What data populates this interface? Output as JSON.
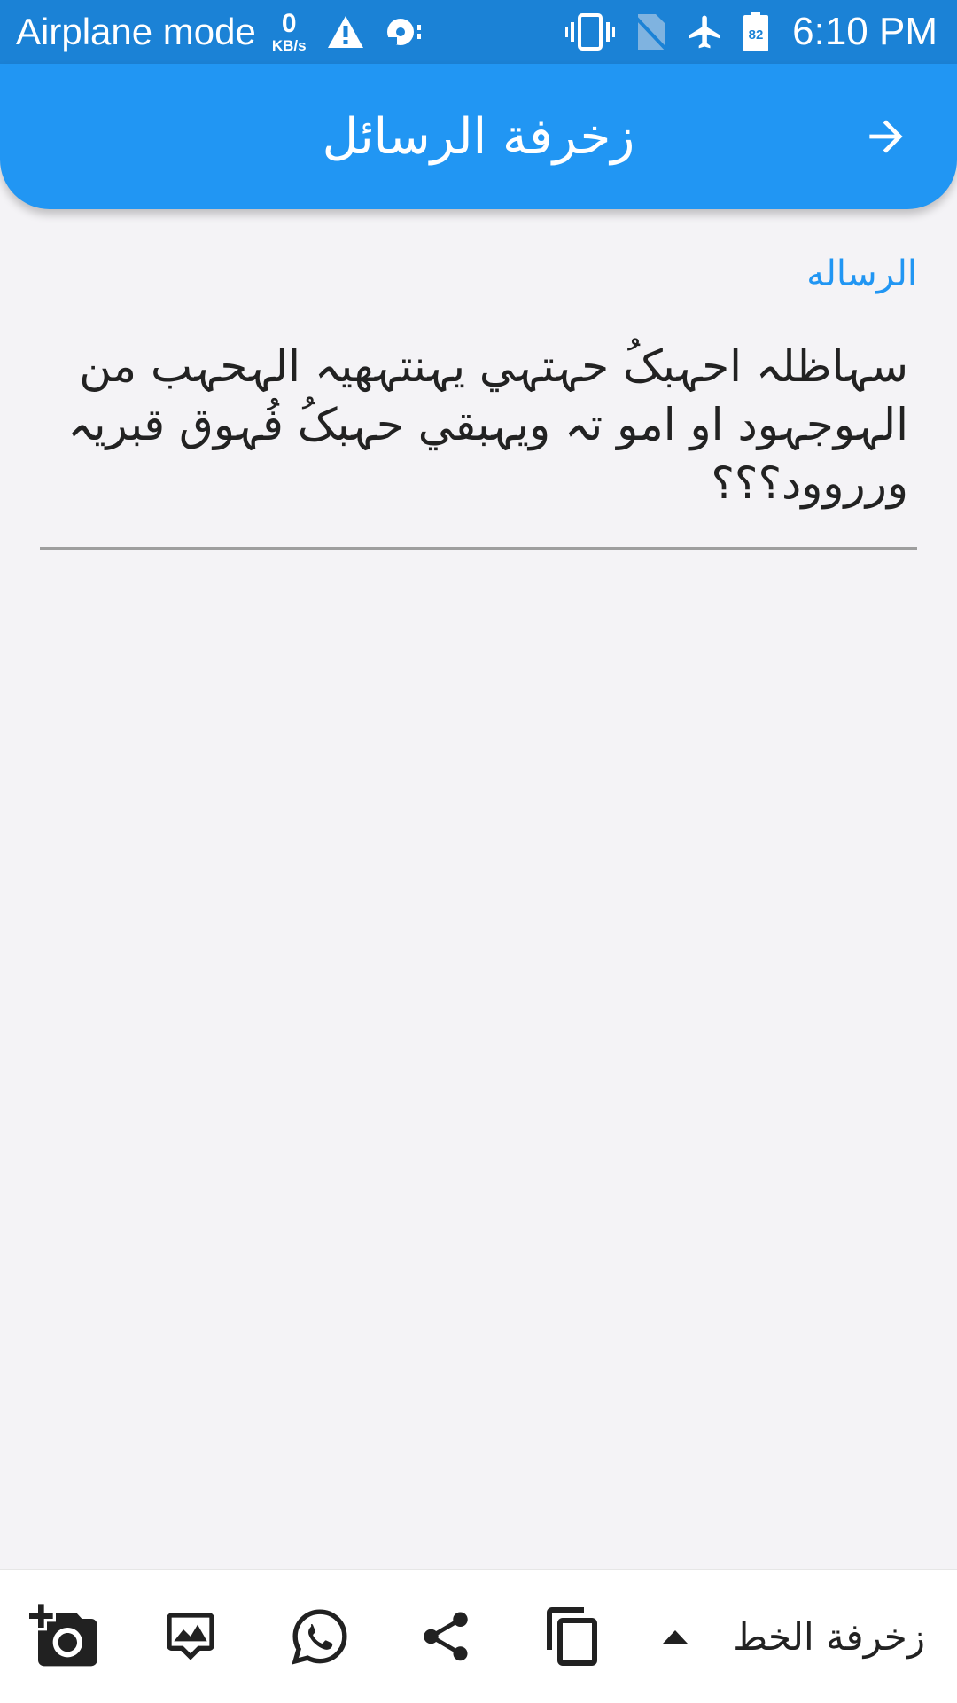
{
  "status_bar": {
    "mode_text": "Airplane mode",
    "speed_value": "0",
    "speed_unit": "KB/s",
    "battery_level": "82",
    "time": "6:10 PM",
    "icons": [
      "warning-icon",
      "cloud-sync-icon",
      "vibrate-icon",
      "no-sim-icon",
      "airplane-icon",
      "battery-icon"
    ]
  },
  "app_bar": {
    "title": "زخرفة الرسائل",
    "back_icon": "arrow-forward-icon"
  },
  "message": {
    "label": "الرساله",
    "value": "سہاظلہ احہبکُ حہتہي يہنتہهيہ الہحہب من الہوجہود او امو تہ ويہبقي حہبکُ فُہوق قبريہ ورروود؟؟؟"
  },
  "toolbar": {
    "font_label": "زخرفة الخط",
    "buttons": [
      "add-photo-icon",
      "image-message-icon",
      "whatsapp-icon",
      "share-icon",
      "copy-icon",
      "dropdown-arrow-icon"
    ]
  },
  "colors": {
    "status_bar": "#1b82d6",
    "app_bar": "#2196f3",
    "accent": "#2196f3",
    "background": "#f4f3f6",
    "underline": "#9e9e9e",
    "icon": "#212121"
  }
}
